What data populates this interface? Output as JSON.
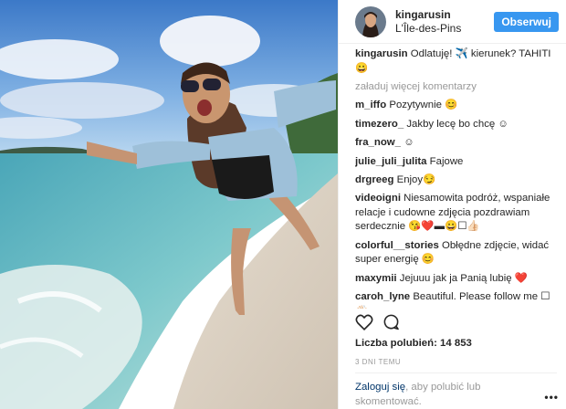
{
  "post": {
    "username": "kingarusin",
    "location": "L'Île-des-Pins",
    "follow_label": "Obserwuj"
  },
  "caption": {
    "user": "kingarusin",
    "text": "Odlatuję! ✈️ kierunek? TAHITI 😀"
  },
  "load_more": "załaduj więcej komentarzy",
  "comments": [
    {
      "user": "m_iffo",
      "text": "Pozytywnie 😊"
    },
    {
      "user": "timezero_",
      "text": "Jakby lecę bo chcę ☺"
    },
    {
      "user": "fra_now_",
      "text": "☺"
    },
    {
      "user": "julie_juli_julita",
      "text": "Fajowe"
    },
    {
      "user": "drgreeg",
      "text": "Enjoy😏"
    },
    {
      "user": "videoigni",
      "text": "Niesamowita podróż, wspaniałe relacje i cudowne zdjęcia pozdrawiam serdecznie 😘❤️▬😀☐👍🏻"
    },
    {
      "user": "colorful__stories",
      "text": "Obłędne zdjęcie, widać super energię 😊"
    },
    {
      "user": "maxymii",
      "text": "Jejuuu jak ja Panią lubię ❤️"
    },
    {
      "user": "caroh_lyne",
      "text": "Beautiful. Please follow me ☐👋🏻"
    }
  ],
  "likes_label": "Liczba polubień: 14 853",
  "time_ago": "3 DNI TEMU",
  "login": {
    "link": "Zaloguj się",
    "rest": ", aby polubić lub skomentować."
  },
  "icons": {
    "like": "heart-icon",
    "comment": "comment-icon",
    "more": "more-options-icon"
  },
  "colors": {
    "follow_button": "#3897f0",
    "link": "#003569",
    "muted": "#999999"
  }
}
